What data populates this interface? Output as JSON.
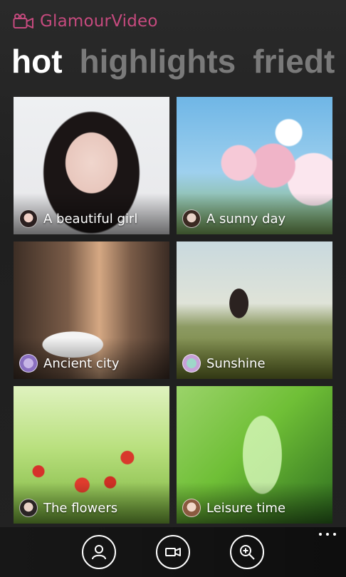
{
  "app": {
    "title": "GlamourVideo",
    "icon": "video-camera-icon",
    "accent_color": "#c64a7e"
  },
  "pivot": {
    "tabs": [
      {
        "label": "hot",
        "active": true
      },
      {
        "label": "highlights",
        "active": false
      },
      {
        "label": "friedt",
        "active": false
      }
    ]
  },
  "tiles": [
    {
      "caption": "A beautiful girl"
    },
    {
      "caption": "A sunny day"
    },
    {
      "caption": "Ancient city"
    },
    {
      "caption": "Sunshine"
    },
    {
      "caption": "The flowers"
    },
    {
      "caption": "Leisure time"
    }
  ],
  "app_bar": {
    "buttons": [
      {
        "icon": "profile-icon"
      },
      {
        "icon": "record-video-icon"
      },
      {
        "icon": "zoom-in-icon"
      }
    ],
    "more_icon": "ellipsis-icon"
  }
}
